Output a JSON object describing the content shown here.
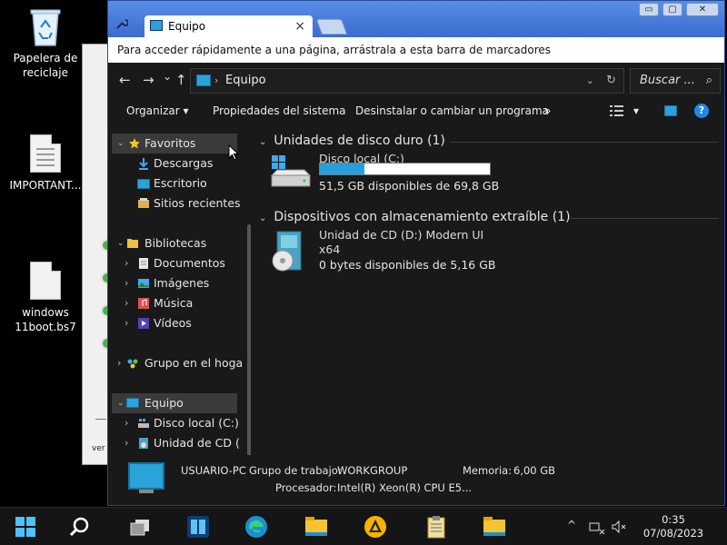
{
  "desktop": {
    "icons": [
      {
        "label": "Papelera de reciclaje",
        "icon": "recycle-bin-icon"
      },
      {
        "label": "IMPORTANT...",
        "icon": "document-icon"
      },
      {
        "label": "windows 11boot.bs7",
        "icon": "document-icon"
      }
    ],
    "bg_window_text": "ver"
  },
  "browser": {
    "tab_title": "Equipo",
    "tab_close": "×",
    "bookmark_hint": "Para acceder rápidamente a una página, arrástrala a esta barra de marcadores",
    "controls": {
      "minimize": "▭",
      "maximize": "▢",
      "close": "✕"
    }
  },
  "explorer": {
    "nav": {
      "back": "←",
      "forward": "→",
      "dropdown": "⌄",
      "up": "↑"
    },
    "address": {
      "separator": "›",
      "location": "Equipo",
      "dropdown": "⌄",
      "refresh": "↻"
    },
    "search": {
      "placeholder": "Buscar ...",
      "icon": "⌕"
    },
    "commands": {
      "organize": "Organizar ▾",
      "system_properties": "Propiedades del sistema",
      "uninstall": "Desinstalar o cambiar un programa",
      "more": "»",
      "view_dropdown": "▾",
      "help": "?"
    },
    "navpane": {
      "favorites": "Favoritos",
      "downloads": "Descargas",
      "desktop": "Escritorio",
      "recent": "Sitios recientes",
      "libraries": "Bibliotecas",
      "documents": "Documentos",
      "pictures": "Imágenes",
      "music": "Música",
      "videos": "Vídeos",
      "homegroup": "Grupo en el hoga",
      "computer": "Equipo",
      "local_disk": "Disco local (C:)",
      "cd_drive": "Unidad de CD (",
      "chev_down": "⌄",
      "chev_right": "›"
    },
    "content": {
      "group_hdd": "Unidades de disco duro (1)",
      "group_removable": "Dispositivos con almacenamiento extraíble (1)",
      "group_chevron": "⌄",
      "drive_c": {
        "name": "Disco local (C:)",
        "free": "51,5 GB disponibles de 69,8 GB",
        "used_fraction": 0.26
      },
      "drive_d": {
        "name": "Unidad de CD (D:) Modern UI",
        "sub": "x64",
        "free": "0 bytes disponibles de 5,16 GB"
      }
    },
    "details": {
      "computer_name": "USUARIO-PC",
      "workgroup_label": "Grupo de trabajo:",
      "workgroup": "WORKGROUP",
      "memory_label": "Memoria:",
      "memory": "6,00 GB",
      "cpu_label": "Procesador:",
      "cpu": "Intel(R) Xeon(R) CPU E5..."
    }
  },
  "taskbar": {
    "items": [
      "start-icon",
      "search-icon",
      "task-view-icon",
      "app-window-icon",
      "edge-icon",
      "file-explorer-icon",
      "app-triangle-icon",
      "clipboard-icon",
      "folder-icon"
    ],
    "tray_chevron": "^",
    "time": "0:35",
    "date": "07/08/2023"
  },
  "colors": {
    "accent": "#26a0da",
    "titlebar": "#3a6cd0",
    "explorer_bg": "#191919"
  }
}
